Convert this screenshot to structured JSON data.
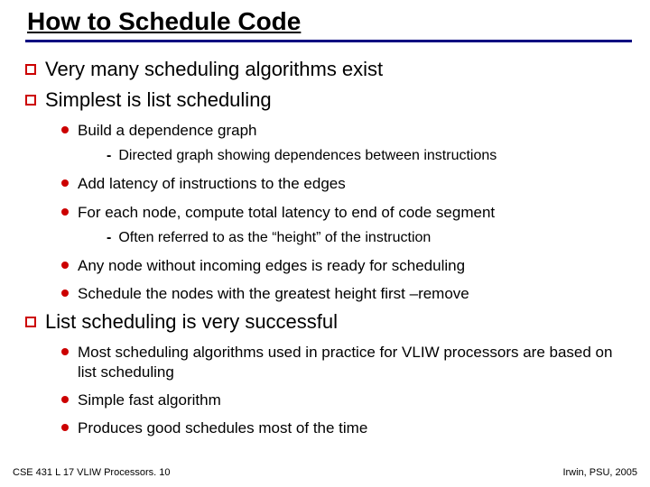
{
  "title": "How to Schedule Code",
  "items": [
    {
      "level": 1,
      "text": "Very many scheduling algorithms exist"
    },
    {
      "level": 1,
      "text": "Simplest is list scheduling"
    },
    {
      "level": 2,
      "text": "Build a dependence graph"
    },
    {
      "level": 3,
      "text": "Directed graph showing dependences between instructions"
    },
    {
      "level": 2,
      "text": "Add latency of instructions to the edges"
    },
    {
      "level": 2,
      "text": "For each node, compute total latency to end of code segment"
    },
    {
      "level": 3,
      "text": "Often referred to as the “height” of the instruction"
    },
    {
      "level": 2,
      "text": "Any node without incoming edges is ready for scheduling"
    },
    {
      "level": 2,
      "text": "Schedule the nodes with the greatest height first –remove"
    },
    {
      "level": 1,
      "text": "List scheduling is very successful"
    },
    {
      "level": 2,
      "text": "Most scheduling algorithms used in practice for VLIW processors are based on list scheduling"
    },
    {
      "level": 2,
      "text": "Simple fast algorithm"
    },
    {
      "level": 2,
      "text": "Produces good schedules most of the time"
    }
  ],
  "footer": {
    "left": "CSE 431  L 17 VLIW Processors. 10",
    "right": "Irwin, PSU, 2005"
  }
}
